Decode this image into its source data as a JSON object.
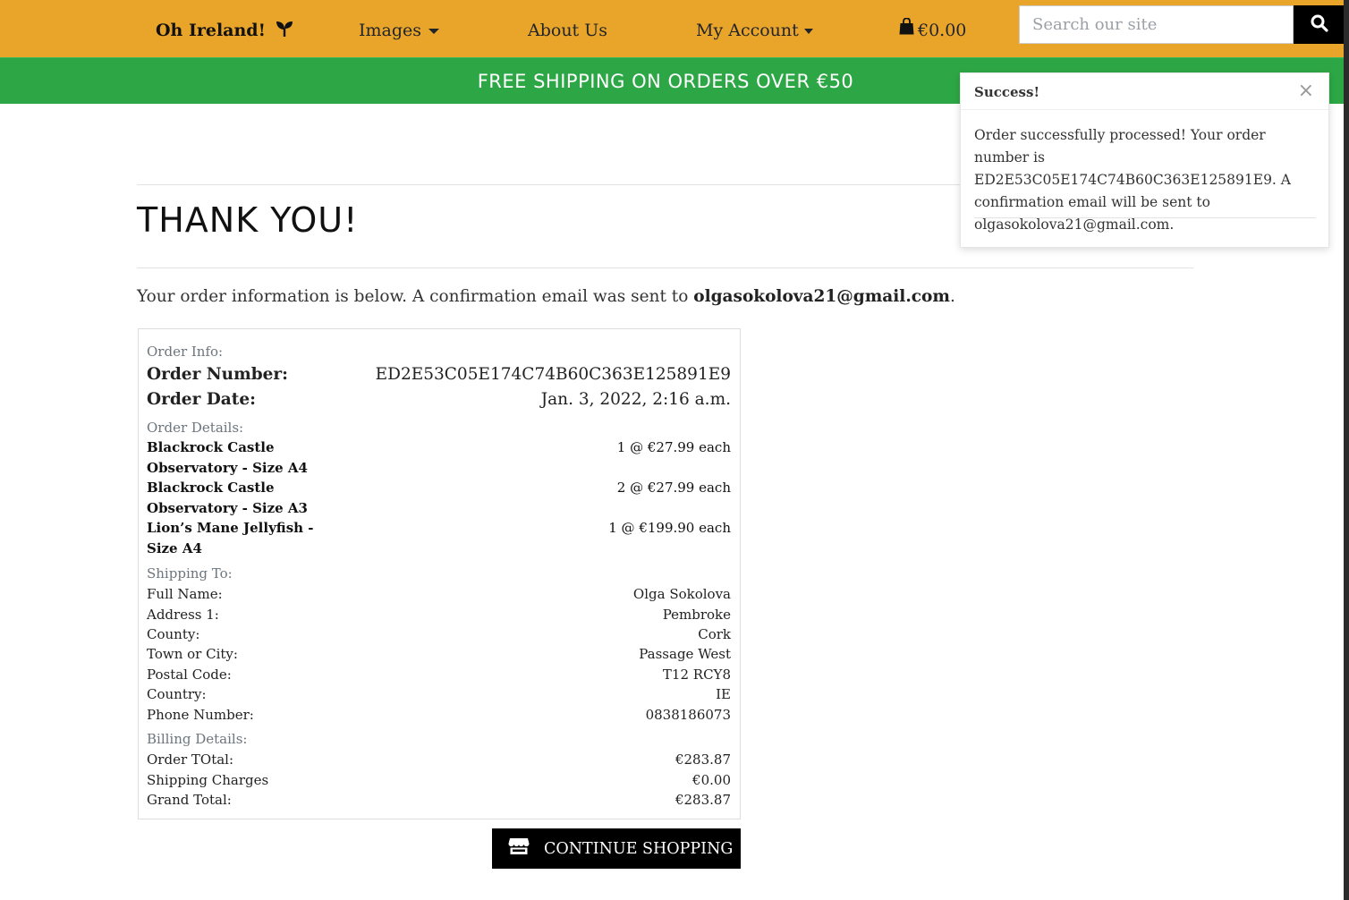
{
  "nav": {
    "brand": "Oh Ireland!",
    "images": "Images",
    "about": "About Us",
    "account": "My Account",
    "cart_total": "€0.00",
    "search_placeholder": "Search our site"
  },
  "banner": {
    "text": "FREE SHIPPING ON ORDERS OVER €50"
  },
  "page": {
    "title": "THANK YOU!",
    "intro_prefix": "Your order information is below. A confirmation email was sent to ",
    "intro_email": "olgasokolova21@gmail.com",
    "intro_suffix": "."
  },
  "order": {
    "info_label": "Order Info:",
    "number_label": "Order Number:",
    "number": "ED2E53C05E174C74B60C363E125891E9",
    "date_label": "Order Date:",
    "date": "Jan. 3, 2022, 2:16 a.m.",
    "details_label": "Order Details:",
    "items": [
      {
        "name": "Blackrock Castle Observatory - Size A4",
        "qty": "1 @ €27.99 each"
      },
      {
        "name": "Blackrock Castle Observatory - Size A3",
        "qty": "2 @ €27.99 each"
      },
      {
        "name": "Lion’s Mane Jellyfish - Size A4",
        "qty": "1 @ €199.90 each"
      }
    ],
    "shipping_label": "Shipping To:",
    "shipping": [
      {
        "label": "Full Name:",
        "value": "Olga Sokolova"
      },
      {
        "label": "Address 1:",
        "value": "Pembroke"
      },
      {
        "label": "County:",
        "value": "Cork"
      },
      {
        "label": "Town or City:",
        "value": "Passage West"
      },
      {
        "label": "Postal Code:",
        "value": "T12 RCY8"
      },
      {
        "label": "Country:",
        "value": "IE"
      },
      {
        "label": "Phone Number:",
        "value": "0838186073"
      }
    ],
    "billing_label": "Billing Details:",
    "billing": [
      {
        "label": "Order TOtal:",
        "value": "€283.87"
      },
      {
        "label": "Shipping Charges",
        "value": "€0.00"
      },
      {
        "label": "Grand Total:",
        "value": "€283.87"
      }
    ]
  },
  "continue_button": "CONTINUE SHOPPING",
  "toast": {
    "title": "Success!",
    "close": "×",
    "message": "Order successfully processed! Your order number is ED2E53C05E174C74B60C363E125891E9. A confirmation email will be sent to olgasokolova21@gmail.com."
  },
  "colors": {
    "nav_bg": "#e9a42a",
    "banner_bg": "#2da745",
    "button_bg": "#000000"
  },
  "icons": [
    "sprout-icon",
    "caret-down-icon",
    "shopping-bag-icon",
    "search-icon",
    "store-icon",
    "close-icon"
  ]
}
